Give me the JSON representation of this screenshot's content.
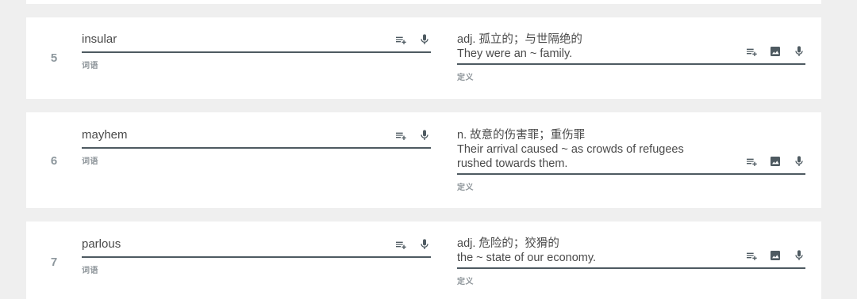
{
  "rows": [
    {
      "number": "5",
      "term": "insular",
      "term_label": "词语",
      "definition_line1": "adj. 孤立的；与世隔绝的",
      "definition_line2": "They were an ~ family.",
      "definition_label": "定义"
    },
    {
      "number": "6",
      "term": "mayhem",
      "term_label": "词语",
      "definition_line1": "n. 故意的伤害罪；重伤罪",
      "definition_line2": "Their arrival caused ~ as crowds of refugees rushed towards them.",
      "definition_label": "定义"
    },
    {
      "number": "7",
      "term": "parlous",
      "term_label": "词语",
      "definition_line1": "adj. 危险的；狡猾的",
      "definition_line2": "the ~ state of our economy.",
      "definition_label": "定义"
    }
  ],
  "icons": {
    "add_to_list": "playlist-add-icon",
    "image": "image-icon",
    "microphone": "microphone-icon"
  }
}
